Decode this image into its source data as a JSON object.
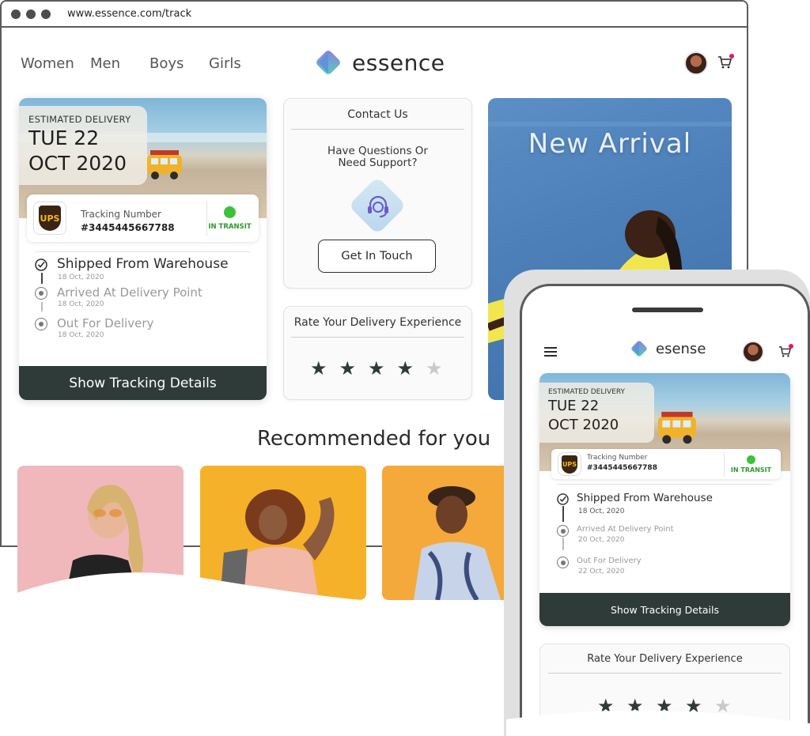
{
  "browser": {
    "url": "www.essence.com/track"
  },
  "nav": {
    "links": [
      "Women",
      "Men",
      "Boys",
      "Girls"
    ],
    "brand": "essence"
  },
  "tracking": {
    "eta_label": "ESTIMATED DELIVERY",
    "eta_line1": "TUE 22",
    "eta_line2": "OCT 2020",
    "carrier_logo_text": "UPS",
    "tracking_label": "Tracking Number",
    "tracking_number": "#3445445667788",
    "status": "IN TRANSIT",
    "steps": [
      {
        "title": "Shipped From Warehouse",
        "date": "18 Oct, 2020",
        "done": true
      },
      {
        "title": "Arrived At Delivery Point",
        "date": "18 Oct, 2020",
        "done": false
      },
      {
        "title": "Out For Delivery",
        "date": "18 Oct, 2020",
        "done": false
      }
    ],
    "button": "Show Tracking Details"
  },
  "contact": {
    "title": "Contact Us",
    "question_line1": "Have Questions Or",
    "question_line2": "Need Support?",
    "button": "Get In Touch"
  },
  "rating": {
    "title": "Rate Your Delivery Experience",
    "stars_total": 5,
    "stars_filled": 4
  },
  "banner": {
    "title": "New Arrival"
  },
  "recommended": {
    "title": "Recommended for you"
  },
  "mobile": {
    "brand": "esense",
    "eta_label": "ESTIMATED DELIVERY",
    "eta_line1": "TUE 22",
    "eta_line2": "OCT 2020",
    "tracking_label": "Tracking Number",
    "tracking_number": "#3445445667788",
    "status": "IN TRANSIT",
    "steps": [
      {
        "title": "Shipped From Warehouse",
        "date": "18 Oct, 2020"
      },
      {
        "title": "Arrived At Delivery Point",
        "date": "20 Oct, 2020"
      },
      {
        "title": "Out For Delivery",
        "date": "22 Oct, 2020"
      }
    ],
    "button": "Show Tracking Details",
    "rating_title": "Rate Your Delivery Experience"
  },
  "colors": {
    "accent_dark": "#2f3b38",
    "status_green": "#3cc23a",
    "cart_badge": "#e8175d",
    "star_off": "#c9c9c9"
  }
}
